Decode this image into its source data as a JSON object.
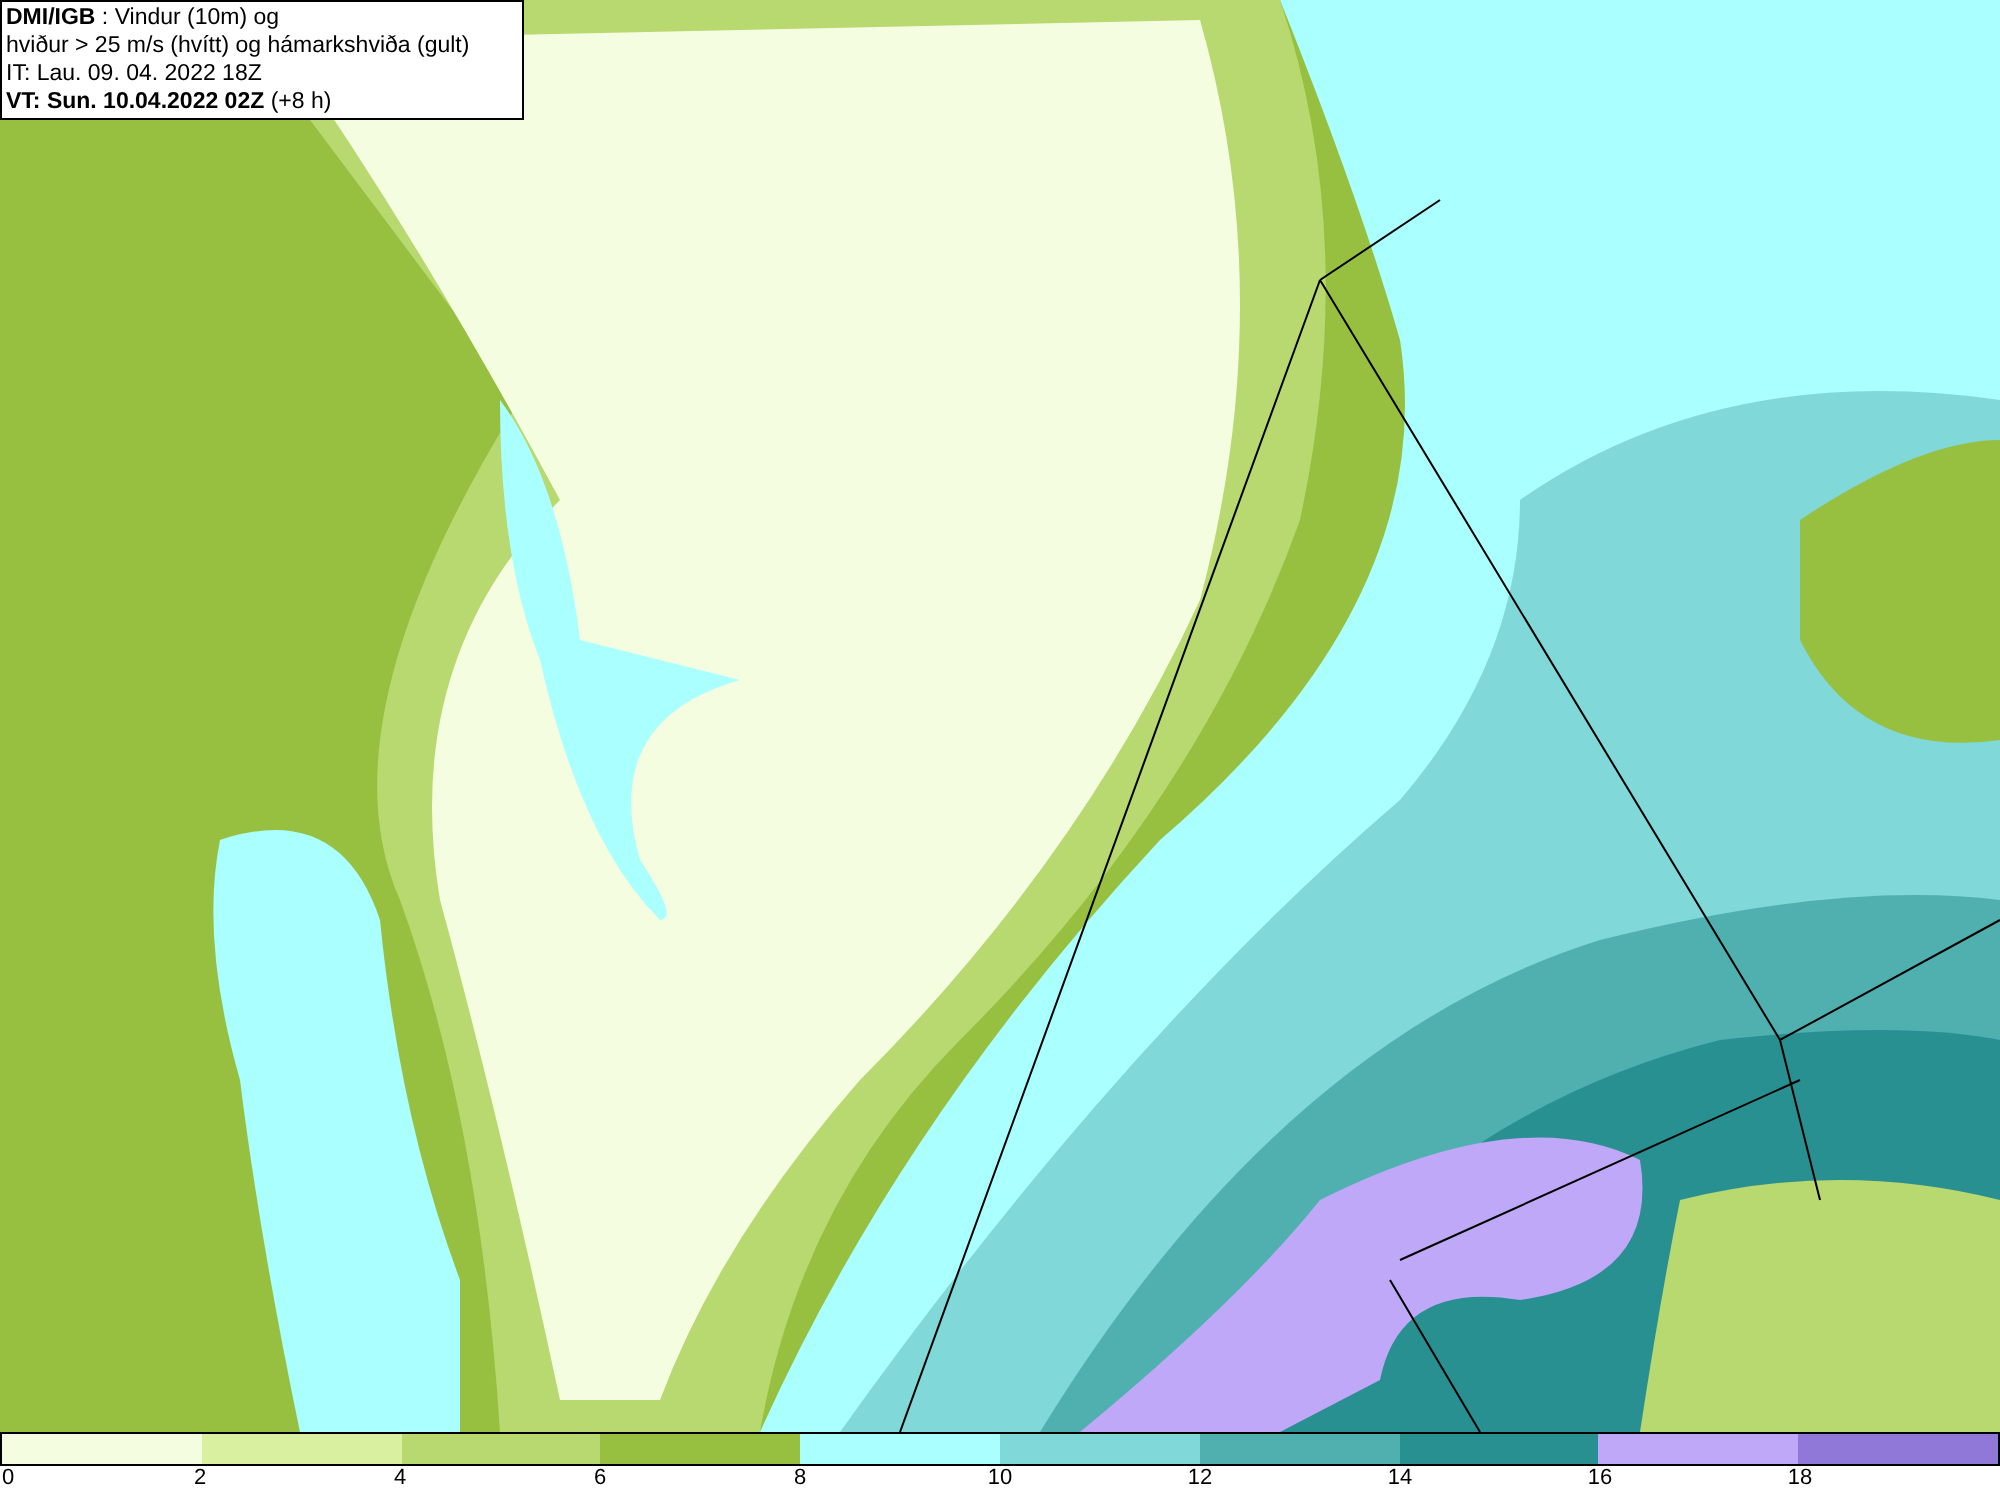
{
  "info_box": {
    "lines": [
      "**DMI/IGB** : Vindur (10m) og",
      "hviður > 25 m/s (hvítt) og hámarkshviða (gult)",
      "IT: Lau. 09. 04. 2022 18Z",
      "**VT: Sun. 10.04.2022 02Z** (+8 h)"
    ]
  },
  "colorbar": {
    "segments": [
      {
        "color": "#f5fde0"
      },
      {
        "color": "#d8f0a0"
      },
      {
        "color": "#b8d870"
      },
      {
        "color": "#98c040"
      },
      {
        "color": "#aaffff"
      },
      {
        "color": "#80d8d8"
      },
      {
        "color": "#50b0b0"
      },
      {
        "color": "#289090"
      },
      {
        "color": "#c0a8f8"
      },
      {
        "color": "#9078d8"
      }
    ],
    "ticks": [
      "0",
      "2",
      "4",
      "6",
      "8",
      "10",
      "12",
      "14",
      "16",
      "18"
    ]
  }
}
